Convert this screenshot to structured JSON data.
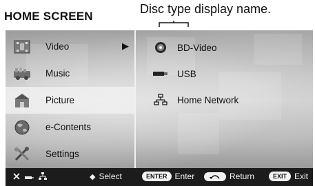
{
  "heading": "HOME SCREEN",
  "callout": "Disc type display name.",
  "menu": {
    "items": [
      {
        "label": "Video",
        "icon": "video-icon"
      },
      {
        "label": "Music",
        "icon": "music-icon"
      },
      {
        "label": "Picture",
        "icon": "picture-icon"
      },
      {
        "label": "e-Contents",
        "icon": "globe-icon"
      },
      {
        "label": "Settings",
        "icon": "settings-icon"
      }
    ],
    "selected_index": 2,
    "submenu_arrow": "▶"
  },
  "sources": {
    "items": [
      {
        "label": "BD-Video",
        "icon": "disc-icon"
      },
      {
        "label": "USB",
        "icon": "usb-icon"
      },
      {
        "label": "Home Network",
        "icon": "network-icon"
      }
    ]
  },
  "status_bar": {
    "select_icon": "◆",
    "select": "Select",
    "enter_key": "ENTER",
    "enter": "Enter",
    "return": "Return",
    "exit_key": "EXIT",
    "exit": "Exit"
  }
}
